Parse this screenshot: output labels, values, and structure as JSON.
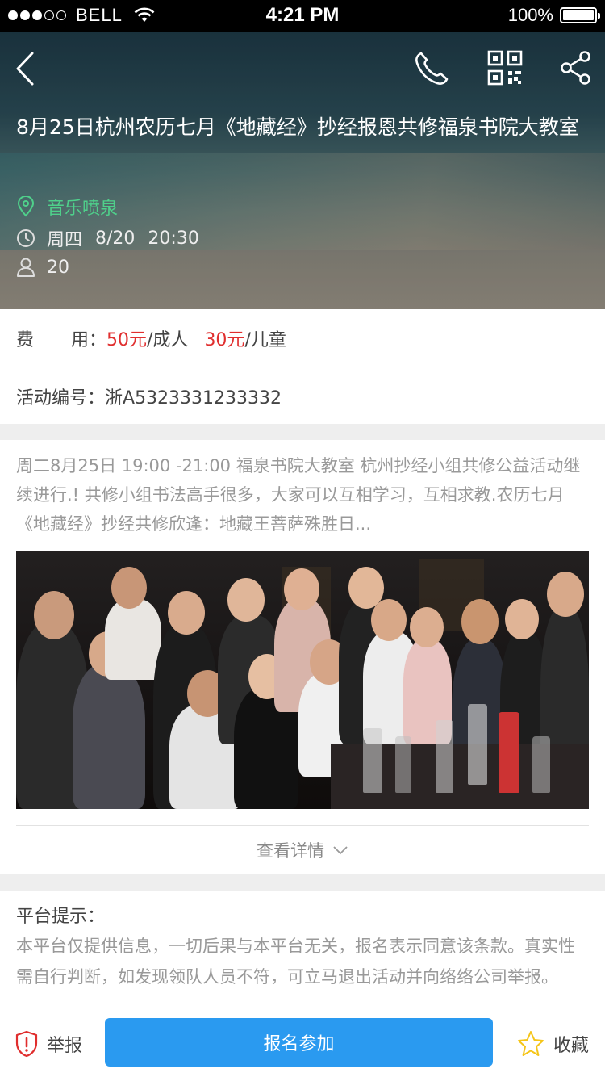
{
  "status_bar": {
    "carrier": "BELL",
    "time": "4:21 PM",
    "battery": "100%",
    "battery_level": 1.0,
    "signal_bars_filled": 3,
    "signal_bars_total": 5
  },
  "header": {
    "back_icon": "chevron-left-icon",
    "phone_icon": "phone-icon",
    "qr_icon": "qr-code-icon",
    "share_icon": "share-icon"
  },
  "event": {
    "title": "8月25日杭州农历七月《地藏经》抄经报恩共修福泉书院大教室",
    "location": "音乐喷泉",
    "weekday": "周四",
    "date": "8/20",
    "time": "20:30",
    "participants": "20",
    "location_color": "#4fd08b"
  },
  "fee": {
    "label": "费",
    "label2": "用：",
    "adult_price": "50元",
    "adult_unit": "/成人",
    "child_price": "30元",
    "child_unit": "/儿童",
    "price_color": "#e02e2e"
  },
  "code": {
    "label": "活动编号：",
    "value": "浙A5323331233332"
  },
  "description": {
    "text": "周二8月25日 19:00 -21:00 福泉书院大教室 杭州抄经小组共修公益活动继续进行.! 共修小组书法高手很多，大家可以互相学习，互相求教.农历七月《地藏经》抄经共修欣逢：地藏王菩萨殊胜日...",
    "more_label": "查看详情"
  },
  "platform_tip": {
    "title": "平台提示：",
    "text": "本平台仅提供信息，一切后果与本平台无关，报名表示同意该条款。真实性需自行判断，如发现领队人员不符，可立马退出活动并向络络公司举报。"
  },
  "bottom_bar": {
    "report_label": "举报",
    "join_label": "报名参加",
    "favorite_label": "收藏",
    "join_color": "#2a9af0",
    "report_icon_color": "#e02e2e",
    "favorite_icon_color": "#f5c518"
  }
}
